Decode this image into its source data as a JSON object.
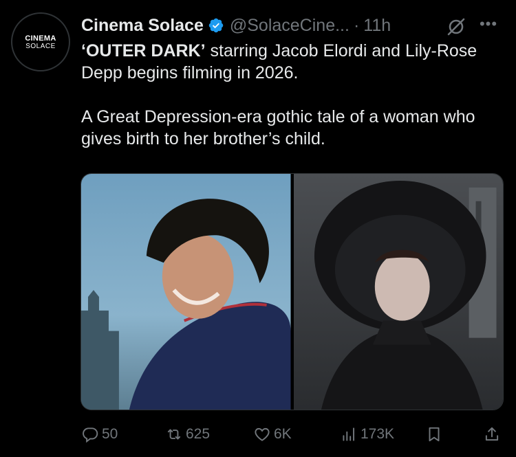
{
  "avatar": {
    "line1": "CINEMA",
    "line2": "SOLACE"
  },
  "tweet": {
    "display_name": "Cinema Solace",
    "handle": "@SolaceCine...",
    "separator": "·",
    "time": "11h",
    "title_bold": "‘OUTER DARK’",
    "line1_rest": " starring Jacob Elordi and Lily-Rose Depp begins filming in 2026.",
    "paragraph2": "A Great Depression-era gothic tale of a woman who gives birth to her brother’s child."
  },
  "actions": {
    "replies": "50",
    "retweets": "625",
    "likes": "6K",
    "views": "173K"
  },
  "icons": {
    "verified": "verified-badge-icon",
    "grok": "grok-icon",
    "more": "more-icon",
    "reply": "reply-icon",
    "retweet": "retweet-icon",
    "like": "heart-icon",
    "views": "views-icon",
    "bookmark": "bookmark-icon",
    "share": "share-icon"
  },
  "colors": {
    "background": "#000000",
    "text": "#e7e9ea",
    "muted": "#71767b",
    "verified": "#1d9bf0"
  }
}
